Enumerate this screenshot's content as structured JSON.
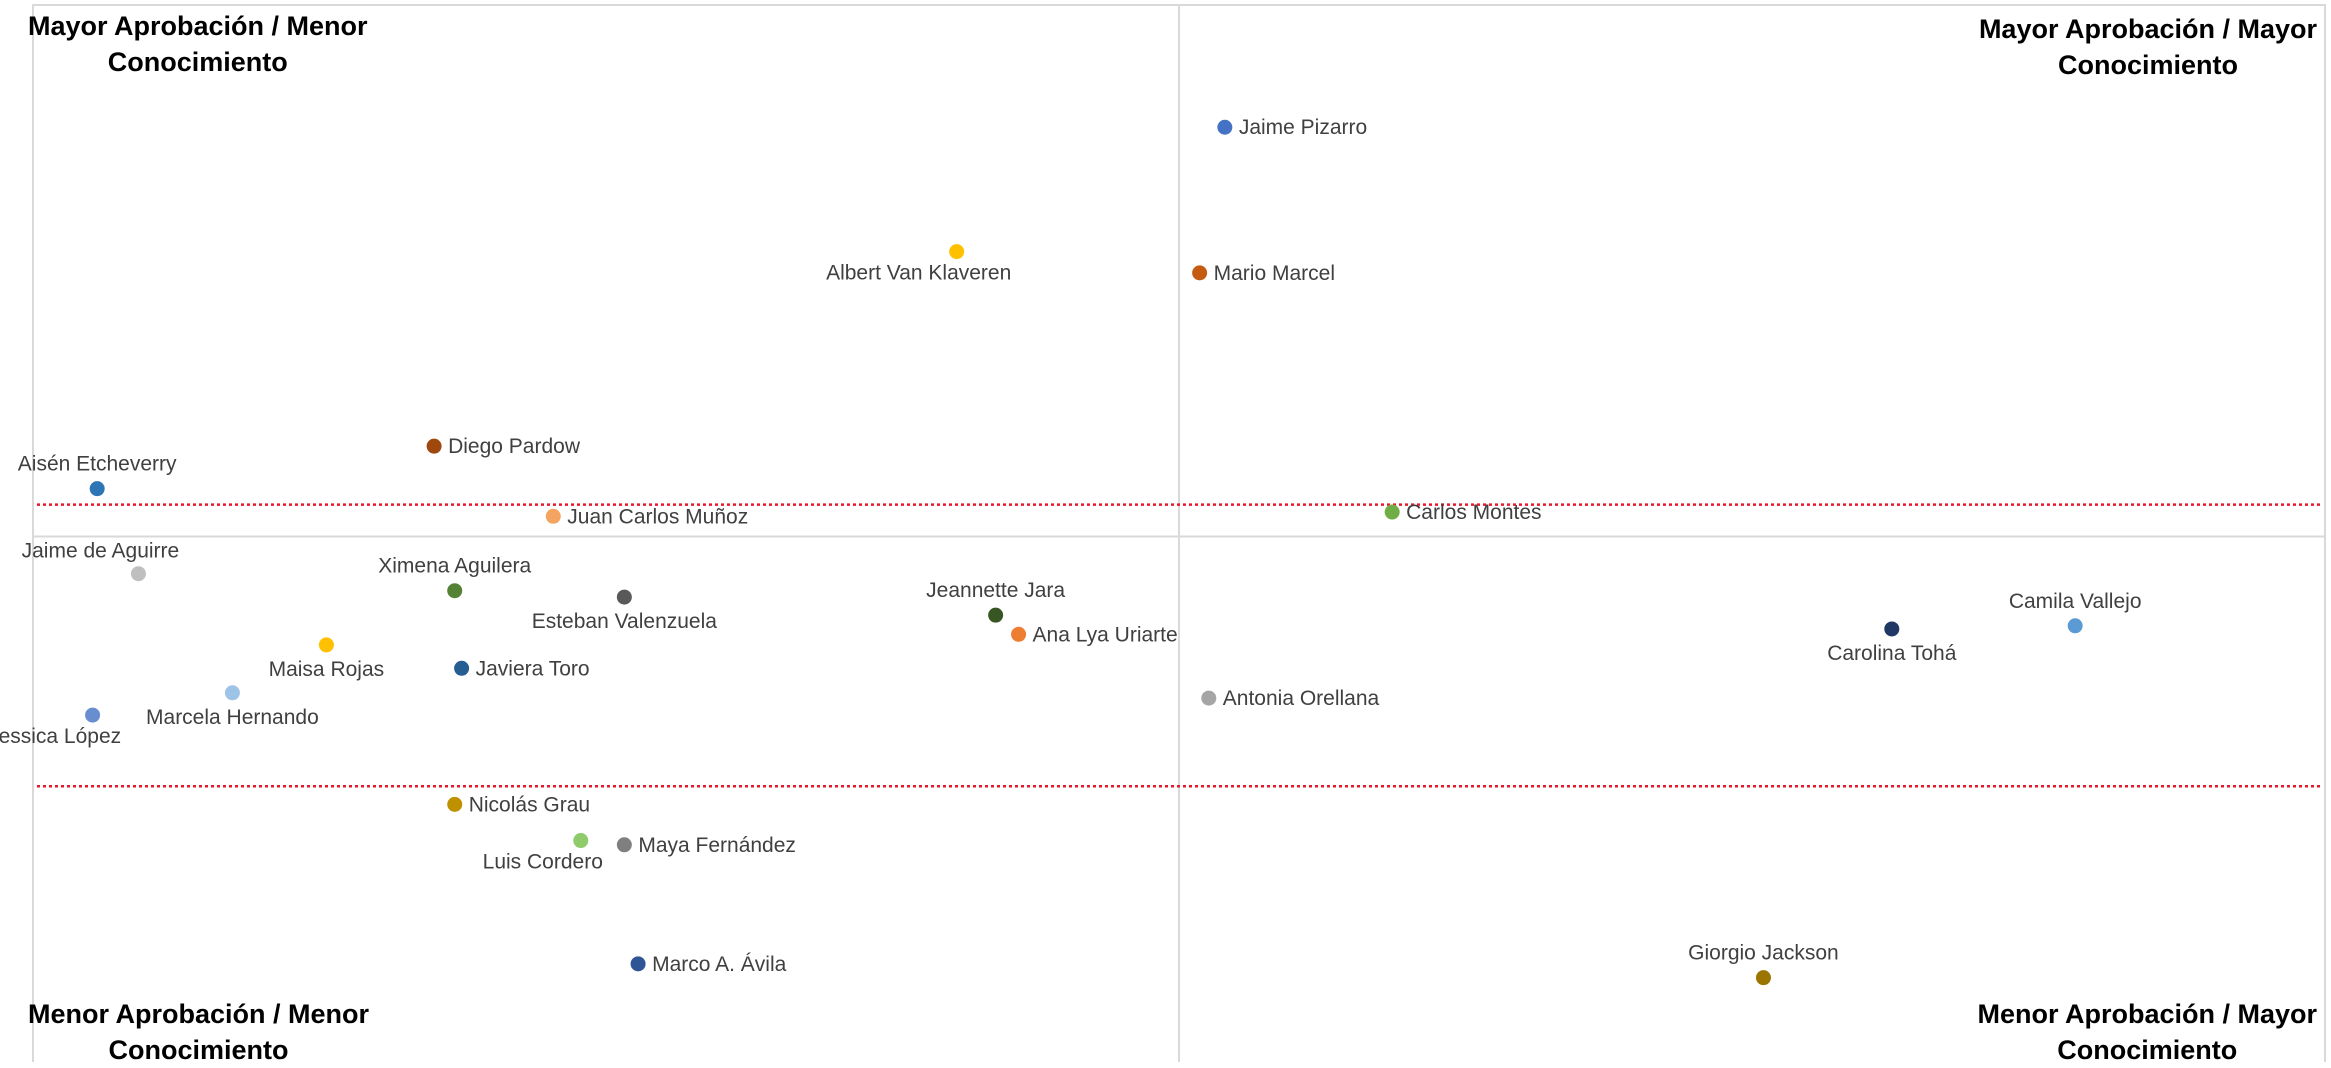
{
  "quadrant_labels": {
    "top_left": [
      "Mayor Aprobación / Menor",
      "Conocimiento"
    ],
    "top_right": [
      "Mayor Aprobación / Mayor",
      "Conocimiento"
    ],
    "bottom_left": [
      "Menor Aprobación / Menor",
      "Conocimiento"
    ],
    "bottom_right": [
      "Menor Aprobación / Mayor",
      "Conocimiento"
    ]
  },
  "chart_data": {
    "type": "scatter",
    "title": "",
    "xlabel": "",
    "ylabel": "",
    "xlim": [
      0,
      100
    ],
    "ylim": [
      0,
      100
    ],
    "grid": false,
    "midlines": {
      "x": 50,
      "y": 50
    },
    "reference_lines_y": [
      53,
      26.5
    ],
    "reference_line_color": "#E8192C",
    "points": [
      {
        "name": "Jaime Pizarro",
        "x": 52,
        "y": 88.5,
        "color": "#4472C4",
        "label_pos": "right"
      },
      {
        "name": "Albert Van Klaveren",
        "x": 40.3,
        "y": 76.8,
        "color": "#FFC000",
        "label_pos": "below-left"
      },
      {
        "name": "Mario Marcel",
        "x": 50.9,
        "y": 74.8,
        "color": "#C55A11",
        "label_pos": "right"
      },
      {
        "name": "Diego Pardow",
        "x": 17.5,
        "y": 58.5,
        "color": "#9E480E",
        "label_pos": "right"
      },
      {
        "name": "Aisén Etcheverry",
        "x": 2.8,
        "y": 54.5,
        "color": "#2E75B6",
        "label_pos": "above"
      },
      {
        "name": "Juan Carlos Muñoz",
        "x": 22.7,
        "y": 51.9,
        "color": "#F4A460",
        "label_pos": "right"
      },
      {
        "name": "Carlos Montes",
        "x": 59.3,
        "y": 52.3,
        "color": "#70AD47",
        "label_pos": "right"
      },
      {
        "name": "Jaime de Aguirre",
        "x": 4.6,
        "y": 46.5,
        "color": "#BFBFBF",
        "label_pos": "above-left"
      },
      {
        "name": "Ximena Aguilera",
        "x": 18.4,
        "y": 44.9,
        "color": "#548235",
        "label_pos": "above"
      },
      {
        "name": "Esteban Valenzuela",
        "x": 25.8,
        "y": 44.3,
        "color": "#595959",
        "label_pos": "below"
      },
      {
        "name": "Jeannette Jara",
        "x": 42,
        "y": 42.6,
        "color": "#375623",
        "label_pos": "above"
      },
      {
        "name": "Ana Lya Uriarte",
        "x": 43,
        "y": 40.8,
        "color": "#ED7D31",
        "label_pos": "right"
      },
      {
        "name": "Maisa Rojas",
        "x": 12.8,
        "y": 39.8,
        "color": "#FFC000",
        "label_pos": "below"
      },
      {
        "name": "Javiera Toro",
        "x": 18.7,
        "y": 37.6,
        "color": "#255E91",
        "label_pos": "right"
      },
      {
        "name": "Marcela Hernando",
        "x": 8.7,
        "y": 35.3,
        "color": "#9DC3E6",
        "label_pos": "below"
      },
      {
        "name": "Jessica López",
        "x": 2.6,
        "y": 33.2,
        "color": "#698ED0",
        "label_pos": "below-left"
      },
      {
        "name": "Antonia Orellana",
        "x": 51.3,
        "y": 34.8,
        "color": "#A5A5A5",
        "label_pos": "right"
      },
      {
        "name": "Carolina Tohá",
        "x": 81.1,
        "y": 41.3,
        "color": "#203864",
        "label_pos": "below"
      },
      {
        "name": "Camila Vallejo",
        "x": 89.1,
        "y": 41.6,
        "color": "#5B9BD5",
        "label_pos": "above"
      },
      {
        "name": "Nicolás Grau",
        "x": 18.4,
        "y": 24.8,
        "color": "#BF9000",
        "label_pos": "right"
      },
      {
        "name": "Luis Cordero",
        "x": 23.9,
        "y": 21.4,
        "color": "#8FCB6A",
        "label_pos": "below-left"
      },
      {
        "name": "Maya Fernández",
        "x": 25.8,
        "y": 21,
        "color": "#7F7F7F",
        "label_pos": "right"
      },
      {
        "name": "Marco A. Ávila",
        "x": 26.4,
        "y": 9.8,
        "color": "#2F5597",
        "label_pos": "right"
      },
      {
        "name": "Giorgio Jackson",
        "x": 75.5,
        "y": 8.5,
        "color": "#9C7500",
        "label_pos": "above"
      }
    ]
  }
}
